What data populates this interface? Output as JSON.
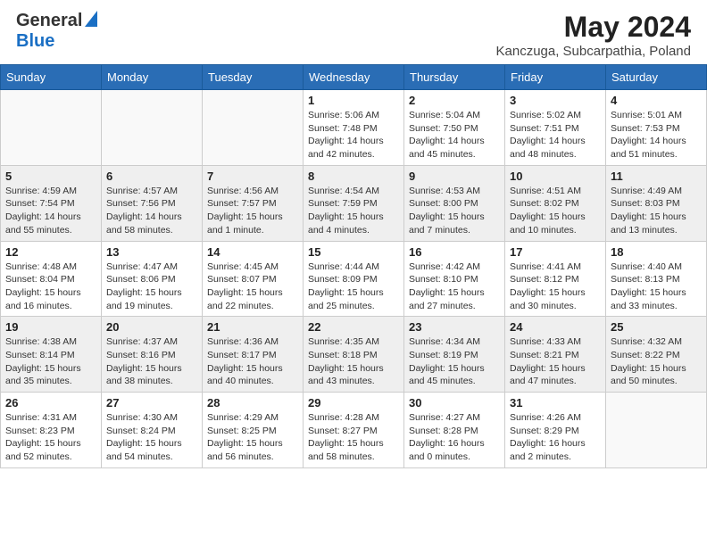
{
  "header": {
    "logo_general": "General",
    "logo_blue": "Blue",
    "month_year": "May 2024",
    "location": "Kanczuga, Subcarpathia, Poland"
  },
  "weekdays": [
    "Sunday",
    "Monday",
    "Tuesday",
    "Wednesday",
    "Thursday",
    "Friday",
    "Saturday"
  ],
  "weeks": [
    [
      {
        "day": null
      },
      {
        "day": null
      },
      {
        "day": null
      },
      {
        "day": 1,
        "sunrise": "5:06 AM",
        "sunset": "7:48 PM",
        "daylight": "14 hours and 42 minutes."
      },
      {
        "day": 2,
        "sunrise": "5:04 AM",
        "sunset": "7:50 PM",
        "daylight": "14 hours and 45 minutes."
      },
      {
        "day": 3,
        "sunrise": "5:02 AM",
        "sunset": "7:51 PM",
        "daylight": "14 hours and 48 minutes."
      },
      {
        "day": 4,
        "sunrise": "5:01 AM",
        "sunset": "7:53 PM",
        "daylight": "14 hours and 51 minutes."
      }
    ],
    [
      {
        "day": 5,
        "sunrise": "4:59 AM",
        "sunset": "7:54 PM",
        "daylight": "14 hours and 55 minutes."
      },
      {
        "day": 6,
        "sunrise": "4:57 AM",
        "sunset": "7:56 PM",
        "daylight": "14 hours and 58 minutes."
      },
      {
        "day": 7,
        "sunrise": "4:56 AM",
        "sunset": "7:57 PM",
        "daylight": "15 hours and 1 minute."
      },
      {
        "day": 8,
        "sunrise": "4:54 AM",
        "sunset": "7:59 PM",
        "daylight": "15 hours and 4 minutes."
      },
      {
        "day": 9,
        "sunrise": "4:53 AM",
        "sunset": "8:00 PM",
        "daylight": "15 hours and 7 minutes."
      },
      {
        "day": 10,
        "sunrise": "4:51 AM",
        "sunset": "8:02 PM",
        "daylight": "15 hours and 10 minutes."
      },
      {
        "day": 11,
        "sunrise": "4:49 AM",
        "sunset": "8:03 PM",
        "daylight": "15 hours and 13 minutes."
      }
    ],
    [
      {
        "day": 12,
        "sunrise": "4:48 AM",
        "sunset": "8:04 PM",
        "daylight": "15 hours and 16 minutes."
      },
      {
        "day": 13,
        "sunrise": "4:47 AM",
        "sunset": "8:06 PM",
        "daylight": "15 hours and 19 minutes."
      },
      {
        "day": 14,
        "sunrise": "4:45 AM",
        "sunset": "8:07 PM",
        "daylight": "15 hours and 22 minutes."
      },
      {
        "day": 15,
        "sunrise": "4:44 AM",
        "sunset": "8:09 PM",
        "daylight": "15 hours and 25 minutes."
      },
      {
        "day": 16,
        "sunrise": "4:42 AM",
        "sunset": "8:10 PM",
        "daylight": "15 hours and 27 minutes."
      },
      {
        "day": 17,
        "sunrise": "4:41 AM",
        "sunset": "8:12 PM",
        "daylight": "15 hours and 30 minutes."
      },
      {
        "day": 18,
        "sunrise": "4:40 AM",
        "sunset": "8:13 PM",
        "daylight": "15 hours and 33 minutes."
      }
    ],
    [
      {
        "day": 19,
        "sunrise": "4:38 AM",
        "sunset": "8:14 PM",
        "daylight": "15 hours and 35 minutes."
      },
      {
        "day": 20,
        "sunrise": "4:37 AM",
        "sunset": "8:16 PM",
        "daylight": "15 hours and 38 minutes."
      },
      {
        "day": 21,
        "sunrise": "4:36 AM",
        "sunset": "8:17 PM",
        "daylight": "15 hours and 40 minutes."
      },
      {
        "day": 22,
        "sunrise": "4:35 AM",
        "sunset": "8:18 PM",
        "daylight": "15 hours and 43 minutes."
      },
      {
        "day": 23,
        "sunrise": "4:34 AM",
        "sunset": "8:19 PM",
        "daylight": "15 hours and 45 minutes."
      },
      {
        "day": 24,
        "sunrise": "4:33 AM",
        "sunset": "8:21 PM",
        "daylight": "15 hours and 47 minutes."
      },
      {
        "day": 25,
        "sunrise": "4:32 AM",
        "sunset": "8:22 PM",
        "daylight": "15 hours and 50 minutes."
      }
    ],
    [
      {
        "day": 26,
        "sunrise": "4:31 AM",
        "sunset": "8:23 PM",
        "daylight": "15 hours and 52 minutes."
      },
      {
        "day": 27,
        "sunrise": "4:30 AM",
        "sunset": "8:24 PM",
        "daylight": "15 hours and 54 minutes."
      },
      {
        "day": 28,
        "sunrise": "4:29 AM",
        "sunset": "8:25 PM",
        "daylight": "15 hours and 56 minutes."
      },
      {
        "day": 29,
        "sunrise": "4:28 AM",
        "sunset": "8:27 PM",
        "daylight": "15 hours and 58 minutes."
      },
      {
        "day": 30,
        "sunrise": "4:27 AM",
        "sunset": "8:28 PM",
        "daylight": "16 hours and 0 minutes."
      },
      {
        "day": 31,
        "sunrise": "4:26 AM",
        "sunset": "8:29 PM",
        "daylight": "16 hours and 2 minutes."
      },
      {
        "day": null
      }
    ]
  ]
}
